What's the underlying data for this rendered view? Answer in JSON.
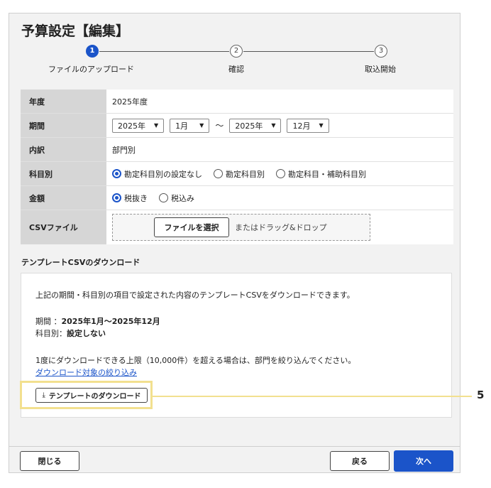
{
  "dialog": {
    "title": "予算設定【編集】"
  },
  "stepper": {
    "steps": [
      {
        "number": "1",
        "label": "ファイルのアップロード",
        "state": "active"
      },
      {
        "number": "2",
        "label": "確認",
        "state": "idle"
      },
      {
        "number": "3",
        "label": "取込開始",
        "state": "idle"
      }
    ]
  },
  "form": {
    "fiscal_year": {
      "label": "年度",
      "value": "2025年度"
    },
    "period": {
      "label": "期間",
      "start_year": "2025年",
      "start_month": "1月",
      "separator": "～",
      "end_year": "2025年",
      "end_month": "12月"
    },
    "breakdown": {
      "label": "内訳",
      "value": "部門別"
    },
    "subject": {
      "label": "科目別",
      "options": [
        "勘定科目別の設定なし",
        "勘定科目別",
        "勘定科目・補助科目別"
      ],
      "selected": "勘定科目別の設定なし"
    },
    "amount": {
      "label": "金額",
      "options": [
        "税抜き",
        "税込み"
      ],
      "selected": "税抜き"
    },
    "csv": {
      "label": "CSVファイル",
      "select_button": "ファイルを選択",
      "drop_hint": "またはドラッグ&ドロップ"
    }
  },
  "template": {
    "heading": "テンプレートCSVのダウンロード",
    "description": "上記の期間・科目別の項目で設定された内容のテンプレートCSVをダウンロードできます。",
    "period_line_label": "期間 ：",
    "period_line_value": "2025年1月～2025年12月",
    "subject_line_label": "科目別：",
    "subject_line_value": "設定しない",
    "limit_note": "1度にダウンロードできる上限（10,000件）を超える場合は、部門を絞り込んでください。",
    "filter_link": "ダウンロード対象の絞り込み",
    "download_button": "テンプレートのダウンロード"
  },
  "callout": {
    "number": "5",
    "color": "#f2e08f"
  },
  "footer": {
    "close_button": "閉じる",
    "back_button": "戻る",
    "next_button": "次へ"
  },
  "colors": {
    "accent": "#1b54c9",
    "label_bg": "#d6d6d6",
    "dialog_bg": "#f2f2f2"
  }
}
